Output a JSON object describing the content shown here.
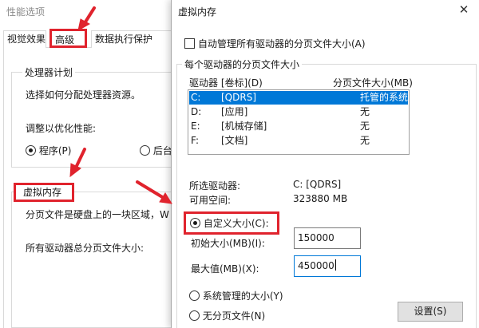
{
  "background_window": {
    "title": "性能选项",
    "tabs": [
      {
        "label": "视觉效果"
      },
      {
        "label": "高级"
      },
      {
        "label": "数据执行保护"
      }
    ],
    "processor_group": {
      "title": "处理器计划",
      "description": "选择如何分配处理器资源。",
      "adjust_label": "调整以优化性能:",
      "option_programs": "程序(P)",
      "option_background": "后台"
    },
    "vm_group": {
      "title": "虚拟内存",
      "description": "分页文件是硬盘上的一块区域，W",
      "total_label": "所有驱动器总分页文件大小:"
    }
  },
  "dialog": {
    "title": "虚拟内存",
    "close_glyph": "✕",
    "auto_manage_label": "自动管理所有驱动器的分页文件大小(A)",
    "auto_manage_checked": false,
    "per_drive_title": "每个驱动器的分页文件大小",
    "list_header": {
      "drive": "驱动器 [卷标](D)",
      "size": "分页文件大小(MB)"
    },
    "drives": [
      {
        "letter": "C:",
        "label": "[QDRS]",
        "size": "托管的系统",
        "selected": true
      },
      {
        "letter": "D:",
        "label": "[应用]",
        "size": "无",
        "selected": false
      },
      {
        "letter": "E:",
        "label": "[机械存储]",
        "size": "无",
        "selected": false
      },
      {
        "letter": "F:",
        "label": "[文档]",
        "size": "无",
        "selected": false
      }
    ],
    "selected_drive_label": "所选驱动器:",
    "selected_drive_value": "C:  [QDRS]",
    "free_space_label": "可用空间:",
    "free_space_value": "323880 MB",
    "custom_size_label": "自定义大小(C):",
    "initial_size_label": "初始大小(MB)(I):",
    "initial_size_value": "150000",
    "max_size_label": "最大值(MB)(X):",
    "max_size_value": "450000",
    "system_managed_label": "系统管理的大小(Y)",
    "no_paging_label": "无分页文件(N)",
    "set_button_label": "设置(S)"
  },
  "colors": {
    "annotation_red": "#e0232d",
    "selection_blue": "#0078d7"
  }
}
